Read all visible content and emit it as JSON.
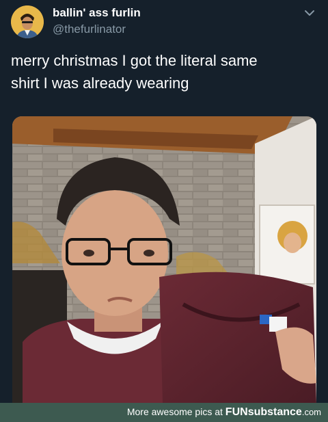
{
  "tweet": {
    "display_name": "ballin' ass furlin",
    "handle": "@thefurlinator",
    "text_line1": "merry christmas I got the literal same",
    "text_line2": "shirt I was already wearing"
  },
  "icons": {
    "menu": "chevron-down-icon"
  },
  "footer": {
    "prefix": "More awesome pics at",
    "brand_fun": "FUN",
    "brand_rest": "substance",
    "brand_domain": ".com"
  },
  "colors": {
    "background": "#15202b",
    "text": "#ffffff",
    "secondary_text": "#8899a6",
    "footer_bar": "#3d5a50"
  }
}
